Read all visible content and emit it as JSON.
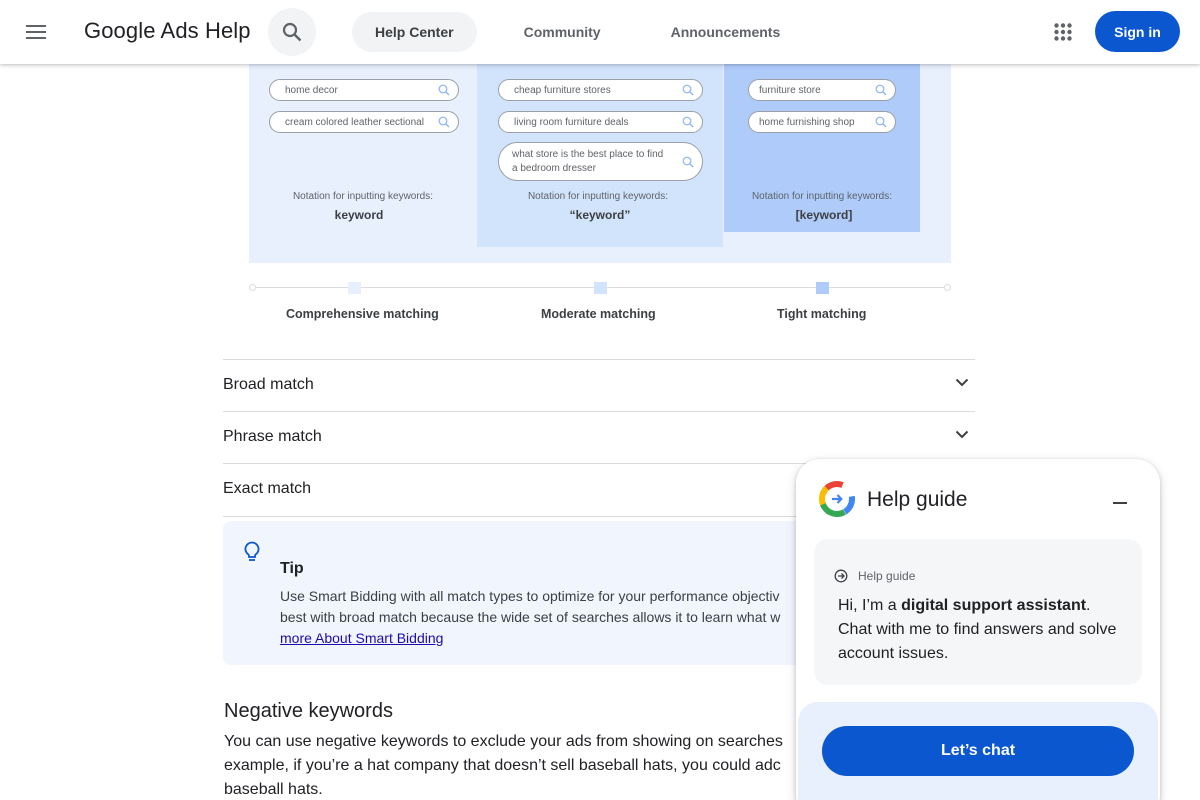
{
  "header": {
    "menu_icon": "menu-icon",
    "brand": "Google Ads Help",
    "search_icon": "search-icon",
    "tabs": [
      {
        "label": "Help Center",
        "active": true
      },
      {
        "label": "Community",
        "active": false
      },
      {
        "label": "Announcements",
        "active": false
      }
    ],
    "apps_icon": "apps-grid-icon",
    "signin_label": "Sign in",
    "accent_color": "#0b57d0"
  },
  "diagram": {
    "broad": {
      "chips": [
        "home decor",
        "cream colored leather sectional"
      ],
      "notation": "Notation for inputting keywords:",
      "keyword": "keyword"
    },
    "phrase": {
      "chips": [
        "cheap furniture stores",
        "living room furniture deals"
      ],
      "chip_multiline": [
        "what store is the best place to find",
        "a bedroom dresser"
      ],
      "notation": "Notation for inputting keywords:",
      "keyword": "“keyword”"
    },
    "exact": {
      "chips": [
        "furniture store",
        "home furnishing shop"
      ],
      "notation": "Notation for inputting keywords:",
      "keyword": "[keyword]"
    },
    "scale": [
      "Comprehensive matching",
      "Moderate matching",
      "Tight matching"
    ]
  },
  "accordions": [
    {
      "title": "Broad match"
    },
    {
      "title": "Phrase match"
    },
    {
      "title": "Exact match"
    }
  ],
  "tip": {
    "icon": "lightbulb-icon",
    "title": "Tip",
    "line1": "Use Smart Bidding with all match types to optimize for your performance objectiv",
    "line2": "best with broad match because the wide set of searches allows it to learn what w",
    "link": "more About Smart Bidding"
  },
  "negative": {
    "title": "Negative keywords",
    "line1": "You can use negative keywords to exclude your ads from showing on searches",
    "line2": "example, if you’re a hat company that doesn’t sell baseball hats, you could adc",
    "line3": "baseball hats."
  },
  "help_guide": {
    "title": "Help guide",
    "logo": "google-g-icon",
    "minimize_icon": "minimize-icon",
    "message_label": "Help guide",
    "message_prefix": "Hi, I’m a ",
    "message_bold": "digital support assistant",
    "message_suffix": ". Chat with me to find answers and solve account issues.",
    "chat_button": "Let’s chat"
  }
}
